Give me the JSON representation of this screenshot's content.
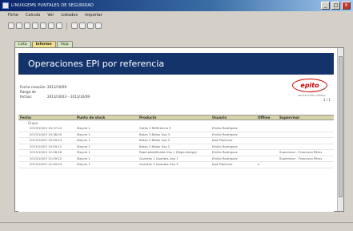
{
  "window": {
    "title": "LINUXGEMS PUNTALES DE SEGURIDAD"
  },
  "menu": [
    "Fiche",
    "Calcula",
    "Ver",
    "Listados",
    "Importar"
  ],
  "tabs": [
    "Lista",
    "Informe",
    "Hoja"
  ],
  "report": {
    "title": "Operaciones EPI por referencia",
    "meta": [
      {
        "key": "Fecha creación:",
        "value": "2013/10/09"
      },
      {
        "key": "Rango de fechas:",
        "value": "2013/10/03 – 2013/10/09"
      }
    ],
    "logo": {
      "text": "epito",
      "sub": "PROTECCIÓN LABORAL"
    },
    "page": "1 / 1",
    "columns": [
      "Fecha",
      "Punto de stock",
      "Producto",
      "Usuario",
      "Offline",
      "Supervisor"
    ],
    "group_label": "Grupo",
    "rows": [
      {
        "fecha": "2013/10/03 10:37:44",
        "punto": "Stayne 1",
        "producto": "Gafas 3 Referencia 3",
        "usuario": "Emilio Rodríguez",
        "offline": "",
        "supervisor": ""
      },
      {
        "fecha": "2013/10/03 10:38:05",
        "punto": "Stayne 1",
        "producto": "Botas 3 Botas Uso 3",
        "usuario": "Emilio Rodríguez",
        "offline": "",
        "supervisor": ""
      },
      {
        "fecha": "2013/10/03 10:59:43",
        "punto": "Stayne 1",
        "producto": "Botas 2 Botas Uso 2",
        "usuario": "José Pastrana",
        "offline": "",
        "supervisor": ""
      },
      {
        "fecha": "2013/10/03 10:59:11",
        "punto": "Stayne 1",
        "producto": "Botas 2 Botas Uso 2",
        "usuario": "Emilio Rodríguez",
        "offline": "",
        "supervisor": ""
      },
      {
        "fecha": "2013/10/03 12:08:28",
        "punto": "Stayne 1",
        "producto": "Ropa plastificada Uso 1 (Ropa Abrigo)",
        "usuario": "Emilio Rodríguez",
        "offline": "",
        "supervisor": "Supervisor - Francisco Pérez"
      },
      {
        "fecha": "2013/10/03 12:09:22",
        "punto": "Stayne 1",
        "producto": "Guantes 1 Guantes Uso 1",
        "usuario": "Emilio Rodríguez",
        "offline": "",
        "supervisor": "Supervisor - Francisco Pérez"
      },
      {
        "fecha": "2013/10/03 12:40:04",
        "punto": "Stayne 1",
        "producto": "Guantes 3 Guantes Uso 3",
        "usuario": "José Pastrana",
        "offline": "x",
        "supervisor": ""
      }
    ]
  }
}
